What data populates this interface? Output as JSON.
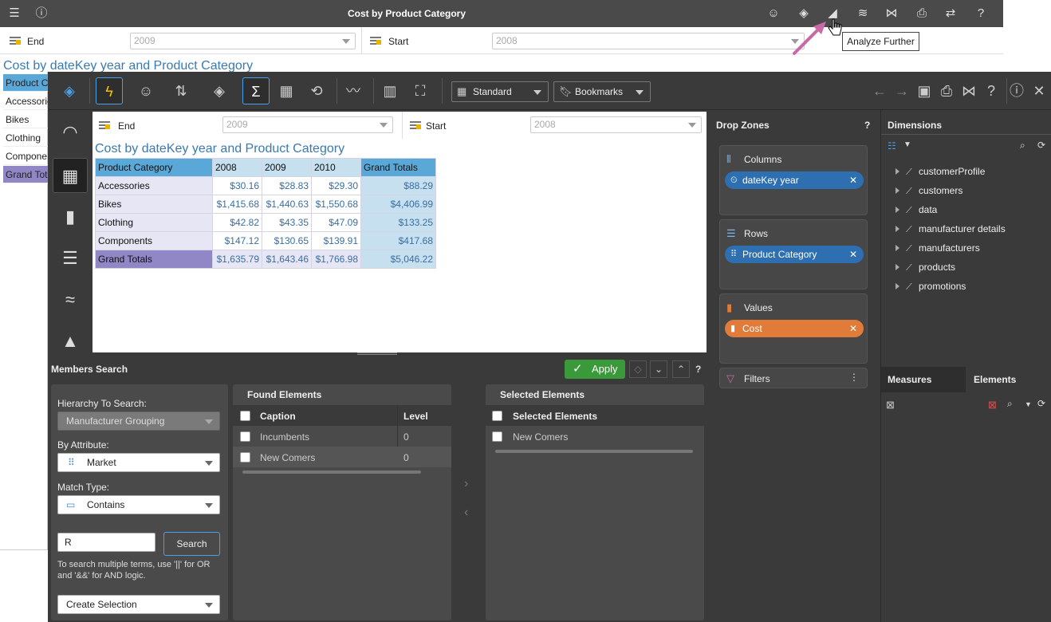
{
  "top_bar": {
    "title": "Cost by Product Category",
    "icons": [
      "menu-icon",
      "info-icon",
      "storyboard-icon",
      "discover-icon",
      "analyze-further-icon",
      "rss-icon",
      "share-icon",
      "print-icon",
      "convert-icon",
      "help-icon"
    ]
  },
  "tooltip": "Analyze Further",
  "background_report": {
    "filter_end_label": "End",
    "filter_end_value": "2009",
    "filter_start_label": "Start",
    "filter_start_value": "2008",
    "title": "Cost by dateKey year and Product Category",
    "rows": [
      "Product C",
      "Accessorie",
      "Bikes",
      "Clothing",
      "Compone",
      "Grand Tota"
    ]
  },
  "toolbar": {
    "view_label": "Standard",
    "bookmarks_label": "Bookmarks"
  },
  "report": {
    "filter_end_label": "End",
    "filter_end_value": "2009",
    "filter_start_label": "Start",
    "filter_start_value": "2008",
    "title": "Cost by dateKey year and Product Category",
    "grid": {
      "corner": "Product Category",
      "columns": [
        "2008",
        "2009",
        "2010"
      ],
      "total_header": "Grand Totals",
      "rows": [
        {
          "label": "Accessories",
          "values": [
            "$30.16",
            "$28.83",
            "$29.30"
          ],
          "total": "$88.29"
        },
        {
          "label": "Bikes",
          "values": [
            "$1,415.68",
            "$1,440.63",
            "$1,550.68"
          ],
          "total": "$4,406.99"
        },
        {
          "label": "Clothing",
          "values": [
            "$42.82",
            "$43.35",
            "$47.09"
          ],
          "total": "$133.25"
        },
        {
          "label": "Components",
          "values": [
            "$147.12",
            "$130.65",
            "$139.91"
          ],
          "total": "$417.68"
        }
      ],
      "grand_row": {
        "label": "Grand Totals",
        "values": [
          "$1,635.79",
          "$1,643.46",
          "$1,766.98"
        ],
        "total": "$5,046.22"
      }
    }
  },
  "members_search": {
    "title": "Members Search",
    "apply_label": "Apply",
    "hierarchy_label": "Hierarchy To Search:",
    "hierarchy_value": "Manufacturer Grouping",
    "attribute_label": "By Attribute:",
    "attribute_value": "Market",
    "match_label": "Match Type:",
    "match_value": "Contains",
    "search_value": "R",
    "search_button": "Search",
    "hint": "To search multiple terms, use '||' for OR and '&&' for AND logic.",
    "create_selection": "Create Selection",
    "found": {
      "title": "Found Elements",
      "caption_header": "Caption",
      "level_header": "Level",
      "rows": [
        {
          "caption": "Incumbents",
          "level": "0"
        },
        {
          "caption": "New Comers",
          "level": "0"
        }
      ]
    },
    "selected": {
      "title": "Selected Elements",
      "header": "Selected Elements",
      "rows": [
        "New Comers"
      ]
    }
  },
  "drop_zones": {
    "title": "Drop Zones",
    "help": "?",
    "columns_label": "Columns",
    "columns_pill": "dateKey year",
    "rows_label": "Rows",
    "rows_pill": "Product Category",
    "values_label": "Values",
    "values_pill": "Cost",
    "filters_label": "Filters",
    "colors": {
      "column_pill": "#2d6fb0",
      "value_pill": "#e07b39"
    }
  },
  "dimensions": {
    "title": "Dimensions",
    "items": [
      "customerProfile",
      "customers",
      "data",
      "manufacturer details",
      "manufacturers",
      "products",
      "promotions"
    ],
    "tab_measures": "Measures",
    "tab_elements": "Elements"
  }
}
